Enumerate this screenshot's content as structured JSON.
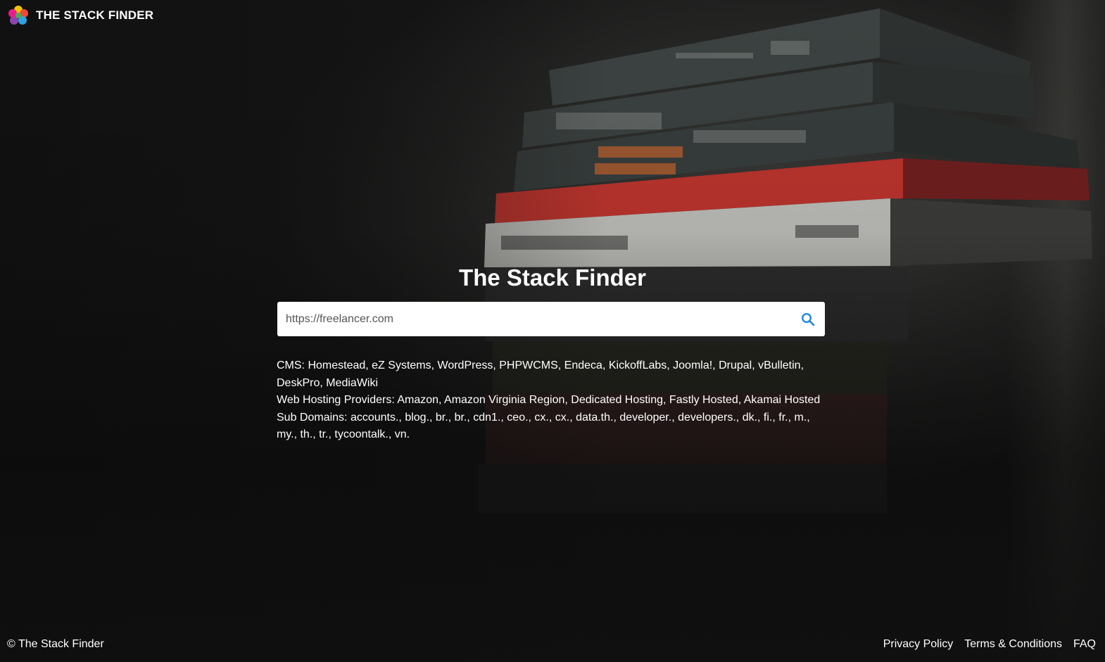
{
  "brand": {
    "name": "THE STACK FINDER",
    "logo_colors": [
      "#f5c400",
      "#e94b3c",
      "#2da3df",
      "#8e44ad",
      "#e91e8c",
      "#4caf50"
    ]
  },
  "main": {
    "title": "The Stack Finder",
    "search": {
      "value": "https://freelancer.com",
      "button_icon": "search-icon",
      "icon_color": "#1e88e5"
    },
    "results": [
      "CMS: Homestead, eZ Systems, WordPress, PHPWCMS, Endeca, KickoffLabs, Joomla!, Drupal, vBulletin, DeskPro, MediaWiki",
      "Web Hosting Providers: Amazon, Amazon Virginia Region, Dedicated Hosting, Fastly Hosted, Akamai Hosted",
      "Sub Domains: accounts., blog., br., br., cdn1., ceo., cx., cx., data.th., developer., developers., dk., fi., fr., m., my., th., tr., tycoontalk., vn."
    ]
  },
  "footer": {
    "copyright": "© The Stack Finder",
    "links": [
      "Privacy Policy",
      "Terms & Conditions",
      "FAQ"
    ]
  }
}
